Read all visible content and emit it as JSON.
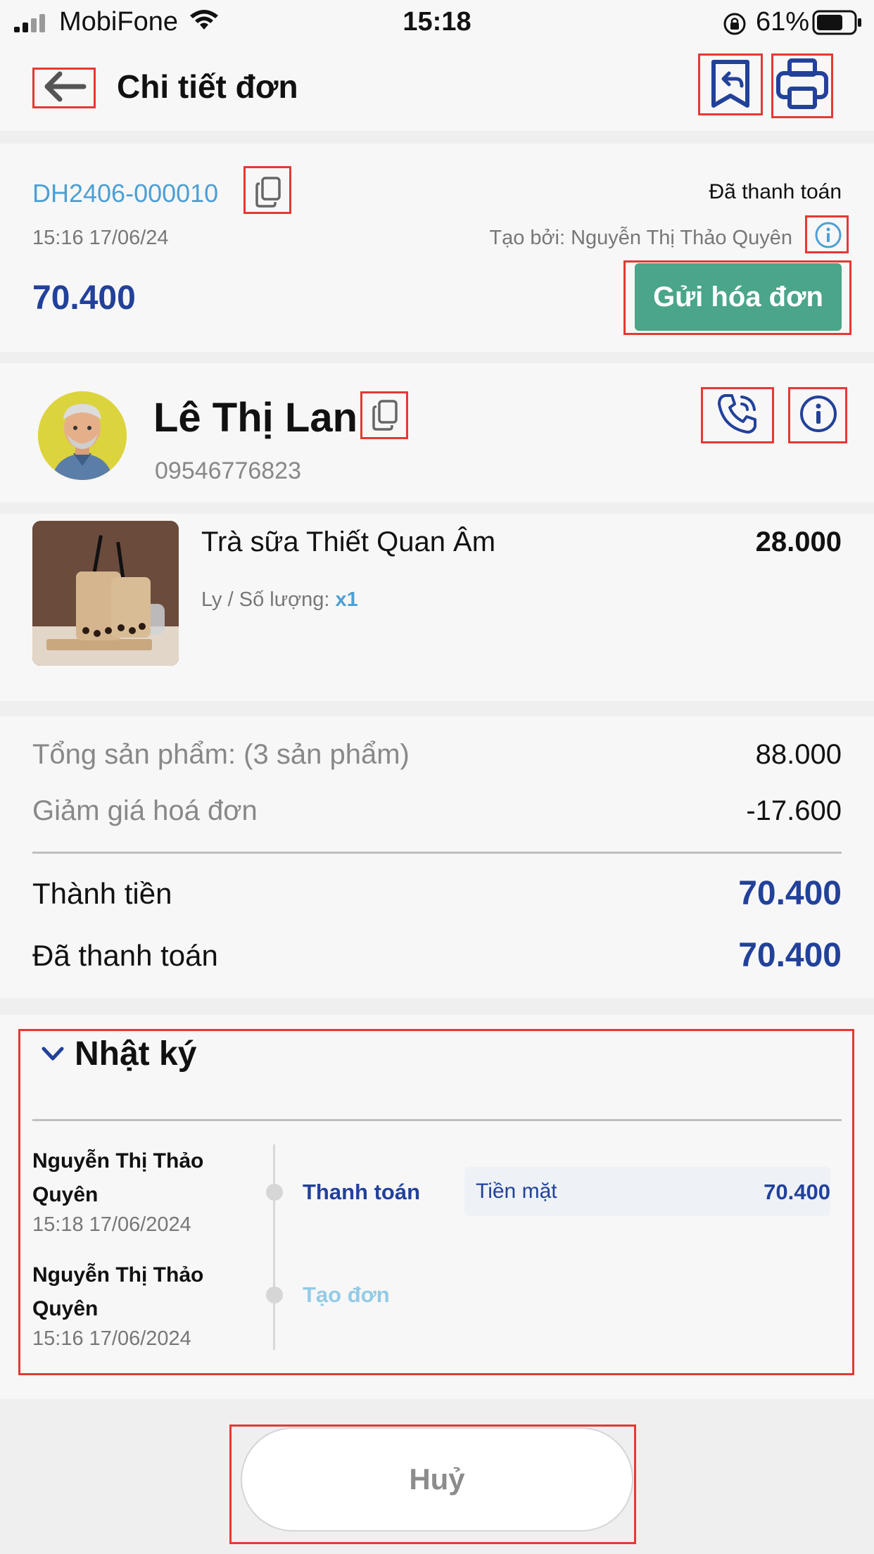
{
  "status_bar": {
    "carrier": "MobiFone",
    "time": "15:18",
    "battery_percent": "61%"
  },
  "header": {
    "title": "Chi tiết đơn",
    "icons": [
      "back-arrow-icon",
      "return-order-icon",
      "printer-icon"
    ]
  },
  "order": {
    "code": "DH2406-000010",
    "payment_status": "Đã thanh toán",
    "created_time": "15:16 17/06/24",
    "created_by": "Tạo bởi: Nguyễn Thị Thảo Quyên",
    "total": "70.400",
    "send_invoice_label": "Gửi hóa đơn"
  },
  "customer": {
    "name": "Lê Thị Lan",
    "phone": "09546776823"
  },
  "items": [
    {
      "name": "Trà sữa Thiết Quan Âm",
      "price": "28.000",
      "qty_label": "Ly / Số lượng: ",
      "qty": "x1"
    }
  ],
  "summary": {
    "subtotal_label": "Tổng sản phẩm: (3 sản phẩm)",
    "subtotal_value": "88.000",
    "discount_label": "Giảm giá hoá đơn",
    "discount_value": "-17.600",
    "total_label": "Thành tiền",
    "total_value": "70.400",
    "paid_label": "Đã thanh toán",
    "paid_value": "70.400"
  },
  "log": {
    "title": "Nhật ký",
    "entries": [
      {
        "user": "Nguyễn Thị Thảo Quyên",
        "time": "15:18 17/06/2024",
        "action": "Thanh toán",
        "method": "Tiền mặt",
        "amount": "70.400"
      },
      {
        "user": "Nguyễn Thị Thảo Quyên",
        "time": "15:16 17/06/2024",
        "action": "Tạo đơn"
      }
    ]
  },
  "footer": {
    "cancel_label": "Huỷ"
  },
  "colors": {
    "brand_blue": "#22419a",
    "link_blue": "#4d9fd4",
    "invoice_green": "#4aa58a",
    "highlight_red": "#e53935"
  }
}
